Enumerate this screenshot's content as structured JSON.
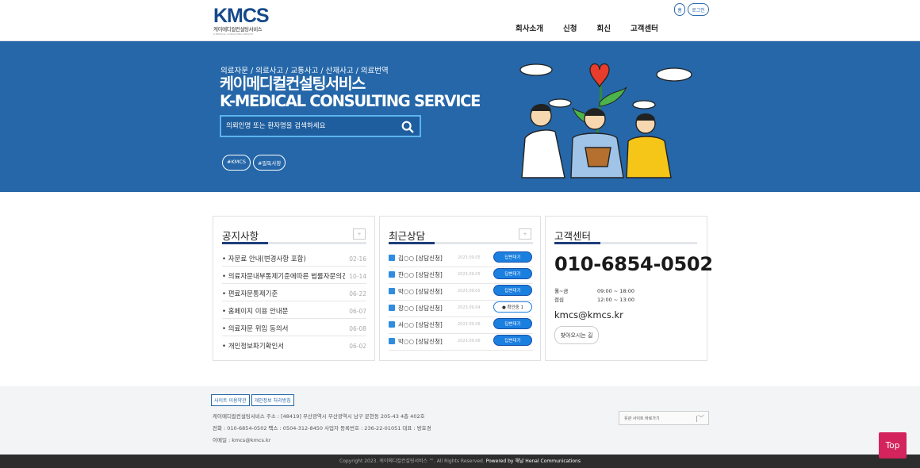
{
  "header": {
    "logo_main": "KMCS",
    "logo_sub": "케이메디컬컨설팅서비스",
    "logo_tag": "K-MEDICAL CONSULTING SERVICE",
    "nav": [
      "회사소개",
      "신청",
      "회신",
      "고객센터"
    ],
    "home_label": "홈",
    "login_label": "로그인"
  },
  "hero": {
    "subtitle": "의료자문 / 의료사고 / 교통사고 / 산재사고 / 의료번역",
    "title_kr": "케이메디컬컨설팅서비스",
    "title_en": "K-MEDICAL CONSULTING SERVICE",
    "search_placeholder": "의뢰인명 또는 환자명을 검색하세요",
    "tags": [
      "#KMCS",
      "#필독사항"
    ]
  },
  "notice": {
    "title": "공지사항",
    "more": "+",
    "items": [
      {
        "title": "자문료 안내(변경사항 포함)",
        "date": "02-16"
      },
      {
        "title": "의료자문내부통제기준에따른 법률자문의견서",
        "date": "10-14"
      },
      {
        "title": "편료자문통제기준",
        "date": "06-22"
      },
      {
        "title": "홈페이지 이용 안내문",
        "date": "06-07"
      },
      {
        "title": "의료자문 위임 동의서",
        "date": "06-08"
      },
      {
        "title": "개인정보파기확인서",
        "date": "06-02"
      }
    ]
  },
  "consult": {
    "title": "최근상담",
    "more": "+",
    "items": [
      {
        "name": "김○○ [상담신청]",
        "date": "2023.09.05",
        "status": "답변대기",
        "waiting": false
      },
      {
        "name": "한○○ [상담신청]",
        "date": "2023.09.05",
        "status": "답변대기",
        "waiting": false
      },
      {
        "name": "박○○ [상담신청]",
        "date": "2023.09.05",
        "status": "답변대기",
        "waiting": false
      },
      {
        "name": "장○○ [상담신청]",
        "date": "2023.09.04",
        "status": "확인중 1",
        "waiting": true
      },
      {
        "name": "서○○ [상담신청]",
        "date": "2023.09.06",
        "status": "답변대기",
        "waiting": false
      },
      {
        "name": "박○○ [상담신청]",
        "date": "2023.09.06",
        "status": "답변대기",
        "waiting": false
      }
    ]
  },
  "support": {
    "title": "고객센터",
    "phone": "010-6854-0502",
    "hours_label1": "월~금",
    "hours_val1": "09:00 ~ 18:00",
    "hours_label2": "점심",
    "hours_val2": "12:00 ~ 13:00",
    "email": "kmcs@kmcs.kr",
    "directions": "찾아오시는 길"
  },
  "footer": {
    "link1": "사이트 이용약관",
    "link2": "개인정보 처리방침",
    "line1": "케이메디컬컨설팅서비스    주소 : [48419] 부산광역시 부산광역시 남구 문현동 205-43 4층 402호",
    "line2": "전화 : 010-6854-0502    팩스 : 0504-312-8450    사업자 등록번호 : 236-22-01051    대표 : 방효경",
    "line3": "이메일 : kmcs@kmcs.kr",
    "select_label": "유관 사이트 바로가기",
    "copyright": "Copyright 2023. 케이메디컬컨설팅서비스 ™. All Rights Reserved. ",
    "powered": "Powered by 해날 Henal Communications",
    "top": "Top"
  }
}
